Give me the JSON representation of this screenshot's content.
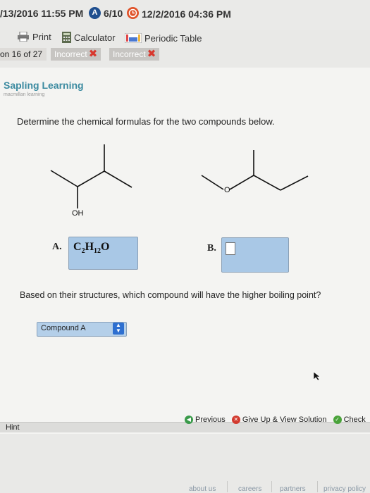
{
  "status": {
    "left_date_time": "/13/2016 11:55 PM",
    "badge_letter": "A",
    "score": "6/10",
    "due_date_time": "12/2/2016 04:36 PM"
  },
  "toolbar": {
    "print": "Print",
    "calculator": "Calculator",
    "periodic_table": "Periodic Table"
  },
  "question_tabs": {
    "current": "on 16 of 27",
    "attempts": [
      "Incorrect",
      "Incorrect"
    ]
  },
  "brand": {
    "name": "Sapling Learning",
    "sub": "macmillan learning"
  },
  "question": {
    "prompt": "Determine the chemical formulas for the two compounds below.",
    "oh_label": "OH",
    "o_label": "O",
    "label_a": "A.",
    "label_b": "B.",
    "answer_a": {
      "c": "C",
      "c_sub": "2",
      "h": "H",
      "h_sub": "12",
      "o": "O"
    },
    "answer_b": "",
    "prompt2": "Based on their structures, which compound will have the higher boiling point?",
    "selected": "Compound A"
  },
  "actions": {
    "previous": "Previous",
    "give_up": "Give Up & View Solution",
    "check": "Check",
    "hint": "Hint"
  },
  "footer": [
    "about us",
    "careers",
    "partners",
    "privacy policy"
  ],
  "colors": {
    "brand": "#3b8aa0",
    "answer_box": "#a9c8e6",
    "incorrect_x": "#d8372d",
    "select_arrow": "#2e6fd0"
  }
}
